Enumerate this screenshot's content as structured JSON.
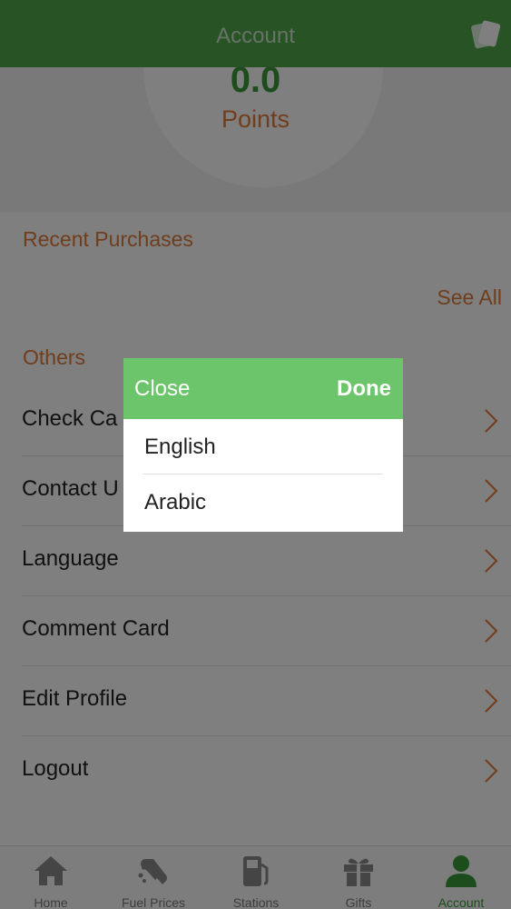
{
  "header": {
    "title": "Account",
    "right_icon": "cards-icon"
  },
  "points": {
    "value": "0.0",
    "label": "Points"
  },
  "recent_purchases": {
    "heading": "Recent Purchases",
    "see_all": "See All"
  },
  "others": {
    "heading": "Others",
    "items": [
      {
        "label": "Check Card",
        "visible_label": "Check Ca"
      },
      {
        "label": "Contact Us",
        "visible_label": "Contact U"
      },
      {
        "label": "Language"
      },
      {
        "label": "Comment Card"
      },
      {
        "label": "Edit Profile"
      },
      {
        "label": "Logout"
      }
    ]
  },
  "tabbar": {
    "tabs": [
      {
        "label": "Home",
        "icon": "home-icon"
      },
      {
        "label": "Fuel Prices",
        "icon": "fuel-nozzle-icon"
      },
      {
        "label": "Stations",
        "icon": "fuel-pump-icon"
      },
      {
        "label": "Gifts",
        "icon": "gift-icon"
      },
      {
        "label": "Account",
        "icon": "person-icon",
        "active": true
      }
    ]
  },
  "language_picker": {
    "close_label": "Close",
    "done_label": "Done",
    "options": [
      "English",
      "Arabic"
    ]
  },
  "colors": {
    "header_green": "#4ea64a",
    "picker_green": "#6cc56a",
    "accent_orange": "#e07a3a",
    "active_tab_green": "#3a9a3a"
  }
}
